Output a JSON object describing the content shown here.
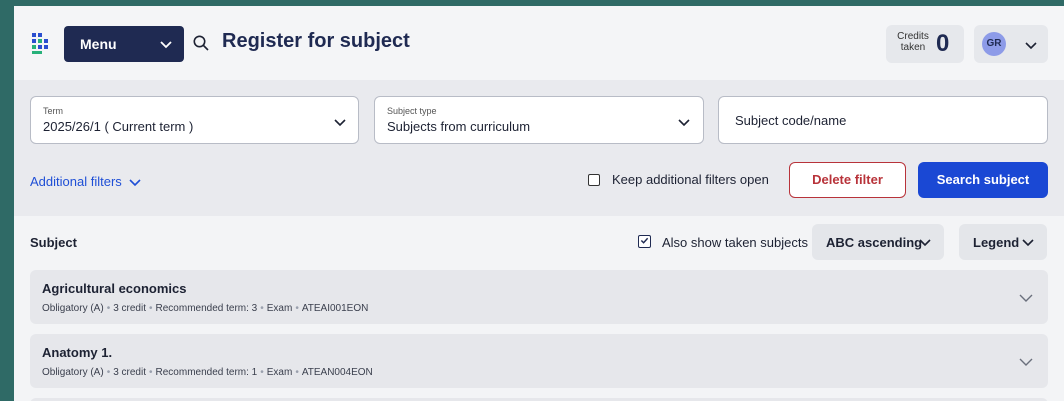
{
  "header": {
    "menu_label": "Menu",
    "title": "Register for subject",
    "credits_label_line1": "Credits",
    "credits_label_line2": "taken",
    "credits_value": "0",
    "user_initials": "GR"
  },
  "filters": {
    "term": {
      "label": "Term",
      "value": "2025/26/1 ( Current term )"
    },
    "subject_type": {
      "label": "Subject type",
      "value": "Subjects from curriculum"
    },
    "subject_code": {
      "placeholder": "Subject code/name"
    },
    "additional_filters": "Additional filters",
    "keep_open_label": "Keep additional filters open",
    "delete_filter": "Delete filter",
    "search_subject": "Search subject"
  },
  "list": {
    "header_label": "Subject",
    "also_show_taken": "Also show taken subjects",
    "sort_label": "ABC ascending",
    "legend_label": "Legend"
  },
  "subjects": [
    {
      "title": "Agricultural economics",
      "meta": [
        "Obligatory (A)",
        "3 credit",
        "Recommended term: 3",
        "Exam",
        "ATEAI001EON"
      ]
    },
    {
      "title": "Anatomy 1.",
      "meta": [
        "Obligatory (A)",
        "3 credit",
        "Recommended term: 1",
        "Exam",
        "ATEAN004EON"
      ]
    }
  ],
  "colors": {
    "primary_navy": "#1f2a52",
    "search_blue": "#1a48d4",
    "delete_red": "#b8333a",
    "outer_teal": "#2f6a66"
  },
  "icons": [
    "logo-icon",
    "chevron-down-icon",
    "search-icon",
    "checkbox-empty-icon",
    "checkbox-checked-icon"
  ]
}
